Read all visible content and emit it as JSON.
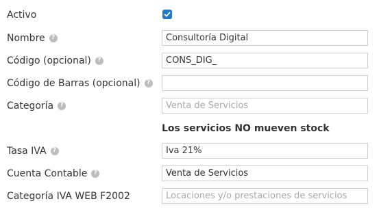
{
  "fields": {
    "activo": {
      "label": "Activo",
      "checked": true
    },
    "nombre": {
      "label": "Nombre",
      "value": "Consultoría Digital"
    },
    "codigo": {
      "label": "Código (opcional)",
      "value": "CONS_DIG_"
    },
    "codigo_barras": {
      "label": "Código de Barras (opcional)",
      "value": ""
    },
    "categoria": {
      "label": "Categoría",
      "placeholder": "Venta de Servicios"
    },
    "stock_notice": "Los servicios NO mueven stock",
    "tasa_iva": {
      "label": "Tasa IVA",
      "value": "Iva 21%"
    },
    "cuenta_contable": {
      "label": "Cuenta Contable",
      "value": "Venta de Servicios"
    },
    "categoria_iva_web": {
      "label": "Categoría IVA WEB F2002",
      "placeholder": "Locaciones y/o prestaciones de servicios"
    }
  },
  "icons": {
    "help": "question-circle-icon",
    "check": "checkmark-icon"
  },
  "colors": {
    "checkbox": "#1f78c8",
    "help_icon": "#bdbdbd",
    "border": "#cfcfcf",
    "placeholder": "#a8a8a8"
  }
}
